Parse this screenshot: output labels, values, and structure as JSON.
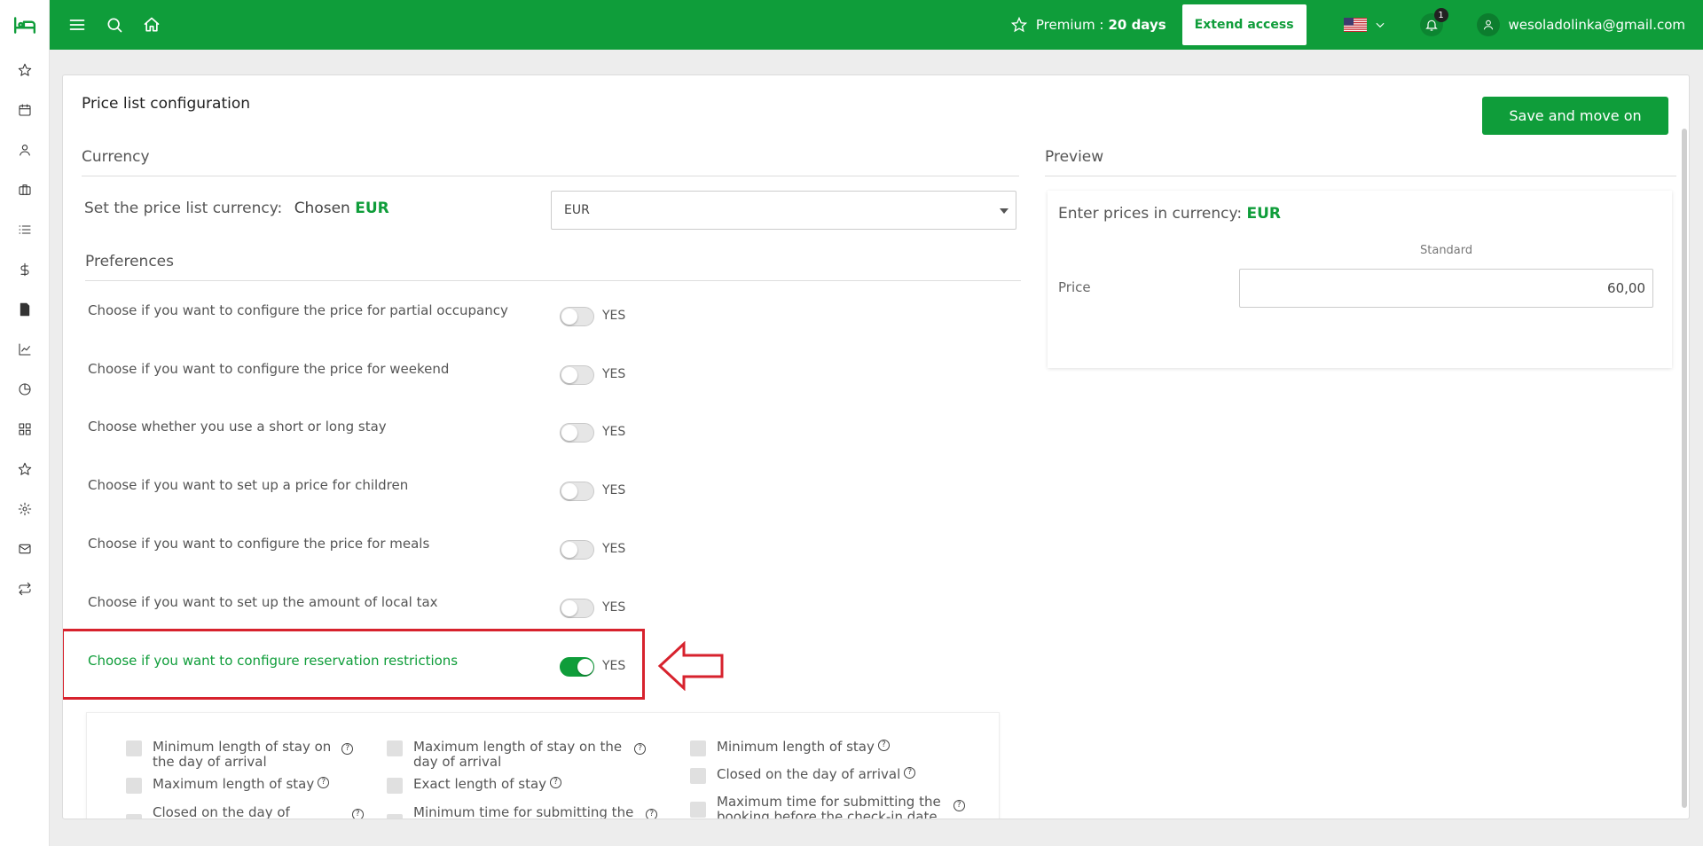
{
  "sidebar": {
    "logo_icon": "bed-icon",
    "items": [
      {
        "icon": "star-icon"
      },
      {
        "icon": "calendar-icon"
      },
      {
        "icon": "user-icon"
      },
      {
        "icon": "briefcase-icon"
      },
      {
        "icon": "list-icon"
      },
      {
        "icon": "dollar-icon"
      },
      {
        "icon": "invoice-icon"
      },
      {
        "icon": "chart-line-icon"
      },
      {
        "icon": "pie-chart-icon"
      },
      {
        "icon": "grid-icon"
      },
      {
        "icon": "star-icon"
      },
      {
        "icon": "gear-icon"
      },
      {
        "icon": "mail-icon"
      },
      {
        "icon": "sync-icon"
      }
    ]
  },
  "topbar": {
    "premium_label": "Premium :",
    "premium_days": "20 days",
    "extend_label": "Extend access",
    "notifications_count": "1",
    "user_email": "wesoladolinka@gmail.com"
  },
  "page": {
    "title": "Price list configuration",
    "save_label": "Save and move on"
  },
  "currency": {
    "heading": "Currency",
    "set_label": "Set the price list currency:",
    "chosen_label": "Chosen",
    "chosen_code": "EUR",
    "select_value": "EUR"
  },
  "preferences": {
    "heading": "Preferences",
    "yes_label": "YES",
    "rows": [
      {
        "label": "Choose if you want to configure the price for partial occupancy",
        "on": false
      },
      {
        "label": "Choose if you want to configure the price for weekend",
        "on": false
      },
      {
        "label": "Choose whether you use a short or long stay",
        "on": false
      },
      {
        "label": "Choose if you want to set up a price for children",
        "on": false
      },
      {
        "label": "Choose if you want to configure the price for meals",
        "on": false
      },
      {
        "label": "Choose if you want to set up the amount of local tax",
        "on": false
      },
      {
        "label": "Choose if you want to configure reservation restrictions",
        "on": true
      }
    ]
  },
  "restrictions": {
    "items": [
      {
        "line1": "Minimum length of stay on",
        "line2": "the day of arrival"
      },
      {
        "line1": "Maximum length of stay on the",
        "line2": "day of arrival"
      },
      {
        "line1": "Minimum length of stay",
        "line2": ""
      },
      {
        "line1": "Maximum length of stay",
        "line2": ""
      },
      {
        "line1": "Exact length of stay",
        "line2": ""
      },
      {
        "line1": "Closed on the day of arrival",
        "line2": ""
      },
      {
        "line1": "Closed on the day of",
        "line2": ""
      },
      {
        "line1": "Minimum time for submitting the",
        "line2": ""
      },
      {
        "line1": "Maximum time for submitting the",
        "line2": "booking before the check-in date"
      }
    ]
  },
  "preview": {
    "heading": "Preview",
    "enter_label": "Enter prices in currency:",
    "currency_code": "EUR",
    "column_label": "Standard",
    "row_label": "Price",
    "price_value": "60,00"
  },
  "colors": {
    "brand_green": "#0f9d3a",
    "highlight_red": "#d7222d"
  }
}
